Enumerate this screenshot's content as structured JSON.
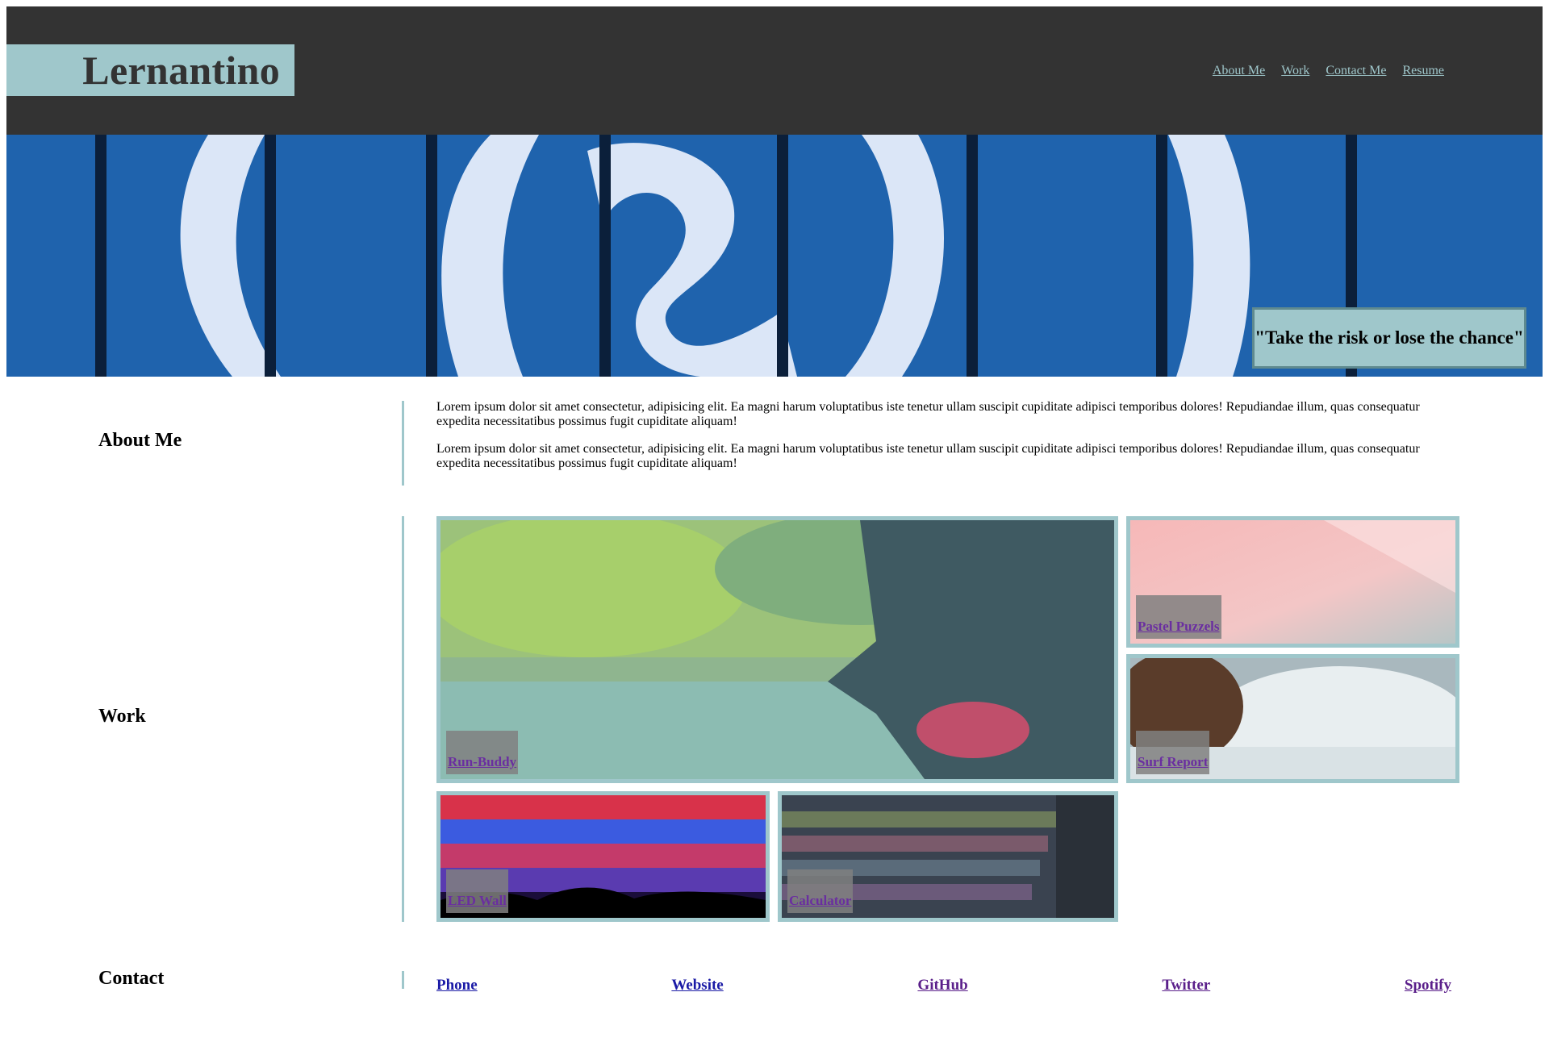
{
  "header": {
    "brand": "Lernantino",
    "nav": [
      {
        "label": "About Me"
      },
      {
        "label": "Work"
      },
      {
        "label": "Contact Me"
      },
      {
        "label": "Resume"
      }
    ]
  },
  "hero": {
    "quote": "\"Take the risk or lose the chance\""
  },
  "about": {
    "title": "About Me",
    "paragraphs": [
      "Lorem ipsum dolor sit amet consectetur, adipisicing elit. Ea magni harum voluptatibus iste tenetur ullam suscipit cupiditate adipisci temporibus dolores! Repudiandae illum, quas consequatur expedita necessitatibus possimus fugit cupiditate aliquam!",
      "Lorem ipsum dolor sit amet consectetur, adipisicing elit. Ea magni harum voluptatibus iste tenetur ullam suscipit cupiditate adipisci temporibus dolores! Repudiandae illum, quas consequatur expedita necessitatibus possimus fugit cupiditate aliquam!"
    ]
  },
  "work": {
    "title": "Work",
    "projects": [
      {
        "name": "Run-Buddy"
      },
      {
        "name": "Pastel Puzzels"
      },
      {
        "name": "Surf Report"
      },
      {
        "name": "LED Wall"
      },
      {
        "name": "Calculator"
      }
    ]
  },
  "contact": {
    "title": "Contact",
    "links": [
      {
        "label": "Phone"
      },
      {
        "label": "Website"
      },
      {
        "label": "GitHub"
      },
      {
        "label": "Twitter"
      },
      {
        "label": "Spotify"
      }
    ]
  },
  "colors": {
    "header_bg": "#333333",
    "accent": "#9fc7cb",
    "hero_blue": "#1e5ea6"
  }
}
